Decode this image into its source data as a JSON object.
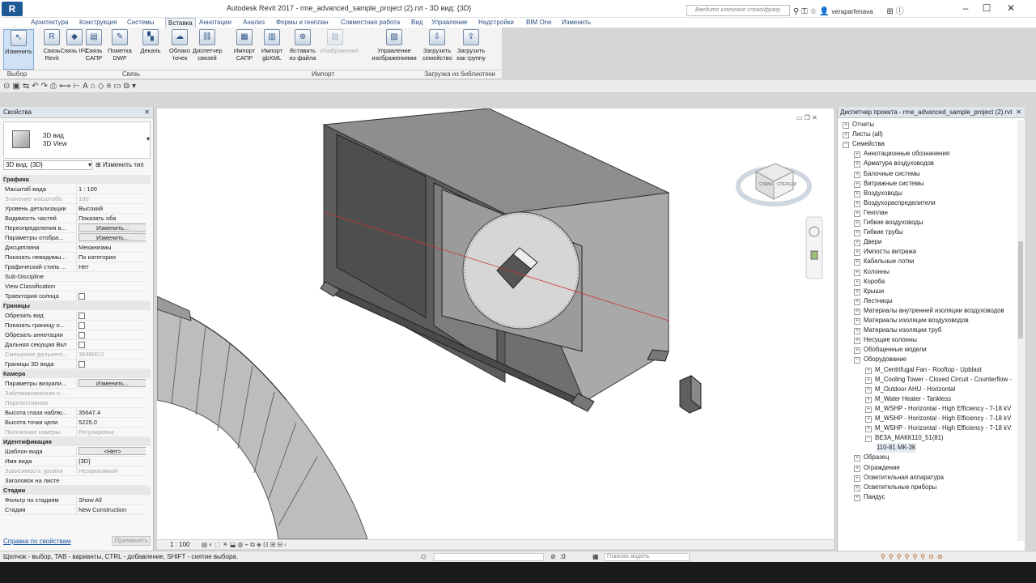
{
  "app": {
    "logo": "R",
    "title": "Autodesk Revit 2017 -    rme_advanced_sample_project (2).rvt - 3D вид: {3D}",
    "search_placeholder": "Введите ключевое слово/фразу",
    "user": "veraparfenava"
  },
  "tabs": [
    "Архитектура",
    "Конструкция",
    "Системы",
    "Вставка",
    "Аннотации",
    "Анализ",
    "Формы и генплан",
    "Совместная работа",
    "Вид",
    "Управление",
    "Надстройки",
    "BIM One",
    "Изменить"
  ],
  "active_tab": "Вставка",
  "ribbon": {
    "buttons": [
      "Изменить",
      "Связь Revit",
      "Связь IFC",
      "Связь САПР",
      "Пометка DWF",
      "Декаль",
      "Облако точек",
      "Диспетчер связей",
      "Импорт САПР",
      "Импорт gbXML",
      "Вставить из файла",
      "Изображение",
      "Управление изображениями",
      "Загрузить семейство",
      "Загрузить как группу"
    ],
    "panels": [
      "Выбор",
      "Связь",
      "Импорт",
      "Загрузка из библиотеки"
    ]
  },
  "properties": {
    "header": "Свойства",
    "type_name": "3D вид",
    "type_sub": "3D View",
    "selector": "3D вид: {3D}",
    "edit_type": "Изменить тип",
    "groups": {
      "graphics": "Графика",
      "bounds": "Границы",
      "camera": "Камера",
      "identity": "Идентификация",
      "phases": "Стадии"
    },
    "rows": [
      {
        "k": "Масштаб вида",
        "v": "1 : 100"
      },
      {
        "k": "Значение масштаба",
        "v": "100",
        "dim": true
      },
      {
        "k": "Уровень детализации",
        "v": "Высокий"
      },
      {
        "k": "Видимость частей",
        "v": "Показать оба"
      },
      {
        "k": "Переопределения в...",
        "v": "Изменить...",
        "btn": true
      },
      {
        "k": "Параметры отобра...",
        "v": "Изменить...",
        "btn": true
      },
      {
        "k": "Дисциплина",
        "v": "Механизмы"
      },
      {
        "k": "Показать невидимы...",
        "v": "По категории"
      },
      {
        "k": "Графический стиль ...",
        "v": "Нет"
      },
      {
        "k": "Sub-Discipline",
        "v": ""
      },
      {
        "k": "View Classification",
        "v": ""
      },
      {
        "k": "Траектория солнца",
        "v": "",
        "chk": true
      },
      {
        "k": "Обрезать вид",
        "v": "",
        "chk": true
      },
      {
        "k": "Показать границу о...",
        "v": "",
        "chk": true
      },
      {
        "k": "Обрезать аннотации",
        "v": "",
        "chk": true
      },
      {
        "k": "Дальняя секущая Вкл",
        "v": "",
        "chk": true
      },
      {
        "k": "Смещение дальнего...",
        "v": "304800.0",
        "dim": true
      },
      {
        "k": "Границы 3D вида",
        "v": "",
        "chk": true
      },
      {
        "k": "Параметры визуали...",
        "v": "Изменить...",
        "btn": true
      },
      {
        "k": "Заблокированная о...",
        "v": "",
        "dim": true
      },
      {
        "k": "Перспективная",
        "v": "",
        "dim": true
      },
      {
        "k": "Высота глаза наблю...",
        "v": "35647.4"
      },
      {
        "k": "Высота точки цели",
        "v": "5225.0"
      },
      {
        "k": "Положение камеры",
        "v": "Регулировка",
        "dim": true
      },
      {
        "k": "Шаблон вида",
        "v": "<Нет>",
        "btn": true
      },
      {
        "k": "Имя вида",
        "v": "{3D}"
      },
      {
        "k": "Зависимость уровня",
        "v": "Независимый",
        "dim": true
      },
      {
        "k": "Заголовок на листе",
        "v": ""
      },
      {
        "k": "Фильтр по стадиям",
        "v": "Show All"
      },
      {
        "k": "Стадия",
        "v": "New Construction"
      }
    ],
    "help_link": "Справка по свойствам",
    "apply": "Применить"
  },
  "browser": {
    "header": "Диспетчер проекта - rme_advanced_sample_project (2).rvt",
    "items": [
      {
        "t": "Отчеты",
        "lvl": 0,
        "tg": "+"
      },
      {
        "t": "Листы (all)",
        "lvl": 0,
        "tg": "+"
      },
      {
        "t": "Семейства",
        "lvl": 0,
        "tg": "−"
      },
      {
        "t": "Аннотационные обозначения",
        "lvl": 1,
        "tg": "+"
      },
      {
        "t": "Арматура воздуховодов",
        "lvl": 1,
        "tg": "+"
      },
      {
        "t": "Балочные системы",
        "lvl": 1,
        "tg": "+"
      },
      {
        "t": "Витражные системы",
        "lvl": 1,
        "tg": "+"
      },
      {
        "t": "Воздуховоды",
        "lvl": 1,
        "tg": "+"
      },
      {
        "t": "Воздухораспределители",
        "lvl": 1,
        "tg": "+"
      },
      {
        "t": "Генплан",
        "lvl": 1,
        "tg": "+"
      },
      {
        "t": "Гибкие воздуховоды",
        "lvl": 1,
        "tg": "+"
      },
      {
        "t": "Гибкие трубы",
        "lvl": 1,
        "tg": "+"
      },
      {
        "t": "Двери",
        "lvl": 1,
        "tg": "+"
      },
      {
        "t": "Импосты витража",
        "lvl": 1,
        "tg": "+"
      },
      {
        "t": "Кабельные лотки",
        "lvl": 1,
        "tg": "+"
      },
      {
        "t": "Колонны",
        "lvl": 1,
        "tg": "+"
      },
      {
        "t": "Короба",
        "lvl": 1,
        "tg": "+"
      },
      {
        "t": "Крыши",
        "lvl": 1,
        "tg": "+"
      },
      {
        "t": "Лестницы",
        "lvl": 1,
        "tg": "+"
      },
      {
        "t": "Материалы внутренней изоляции воздуховодов",
        "lvl": 1,
        "tg": "+"
      },
      {
        "t": "Материалы изоляции воздуховодов",
        "lvl": 1,
        "tg": "+"
      },
      {
        "t": "Материалы изоляции труб",
        "lvl": 1,
        "tg": "+"
      },
      {
        "t": "Несущие колонны",
        "lvl": 1,
        "tg": "+"
      },
      {
        "t": "Обобщенные модели",
        "lvl": 1,
        "tg": "+"
      },
      {
        "t": "Оборудование",
        "lvl": 1,
        "tg": "−"
      },
      {
        "t": "M_Centrifugal Fan -  Rooftop - Upblast",
        "lvl": 2,
        "tg": "+"
      },
      {
        "t": "M_Cooling Tower - Closed Circuit - Counterflow -",
        "lvl": 2,
        "tg": "+"
      },
      {
        "t": "M_Outdoor AHU - Horizontal",
        "lvl": 2,
        "tg": "+"
      },
      {
        "t": "M_Water Heater - Tankless",
        "lvl": 2,
        "tg": "+"
      },
      {
        "t": "M_WSHP - Horizontal - High Efficiency - 7-18 kV",
        "lvl": 2,
        "tg": "+"
      },
      {
        "t": "M_WSHP - Horizontal - High Efficiency - 7-18 kV",
        "lvl": 2,
        "tg": "+"
      },
      {
        "t": "M_WSHP - Horizontal - High Efficiency - 7-18 kV",
        "lvl": 2,
        "tg": "+"
      },
      {
        "t": "ВЕЗА_МАКК110_51(81)",
        "lvl": 2,
        "tg": "−"
      },
      {
        "t": "110-81 МК-3К",
        "lvl": 3,
        "tg": "",
        "sel": true
      },
      {
        "t": "Образец",
        "lvl": 1,
        "tg": "+"
      },
      {
        "t": "Ограждение",
        "lvl": 1,
        "tg": "+"
      },
      {
        "t": "Осветительная аппаратура",
        "lvl": 1,
        "tg": "+"
      },
      {
        "t": "Осветительные приборы",
        "lvl": 1,
        "tg": "+"
      },
      {
        "t": "Пандус",
        "lvl": 1,
        "tg": "+"
      }
    ]
  },
  "viewcube": {
    "left": "СЛЕВА",
    "front": "СПЕРЕДИ"
  },
  "view_scale": "1 : 100",
  "statusbar": {
    "hint": "Щелчок - выбор, TAB - варианты, CTRL - добавление, SHIFT - снятие выбора.",
    "count": ":0",
    "model": "Главная модель"
  }
}
